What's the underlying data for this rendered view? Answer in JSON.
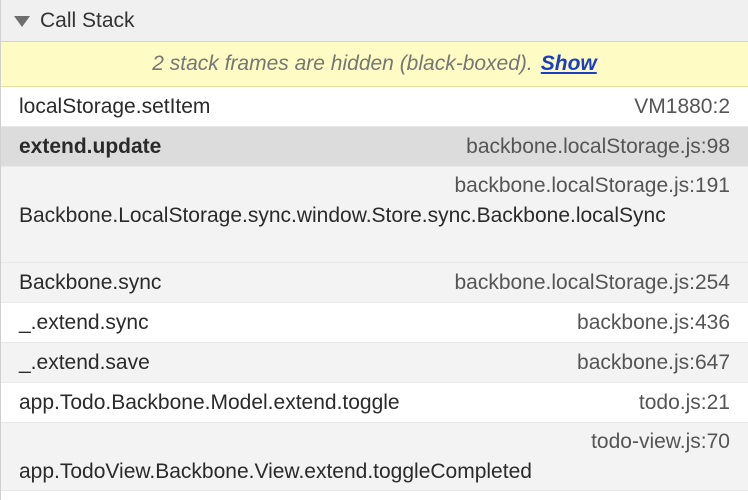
{
  "header": {
    "title": "Call Stack"
  },
  "banner": {
    "message": "2 stack frames are hidden (black-boxed).",
    "show_label": "Show"
  },
  "frames": [
    {
      "fn": "localStorage.setItem",
      "loc": "VM1880:2"
    },
    {
      "fn": "extend.update",
      "loc": "backbone.localStorage.js:98"
    },
    {
      "fn": "Backbone.LocalStorage.sync.window.Store.sync.Backbone.localSync",
      "loc": "backbone.localStorage.js:191"
    },
    {
      "fn": "Backbone.sync",
      "loc": "backbone.localStorage.js:254"
    },
    {
      "fn": "_.extend.sync",
      "loc": "backbone.js:436"
    },
    {
      "fn": "_.extend.save",
      "loc": "backbone.js:647"
    },
    {
      "fn": "app.Todo.Backbone.Model.extend.toggle",
      "loc": "todo.js:21"
    },
    {
      "fn": "app.TodoView.Backbone.View.extend.toggleCompleted",
      "loc": "todo-view.js:70"
    }
  ],
  "colors": {
    "banner_bg": "#fffbc4",
    "link": "#1a3fc0",
    "selected_bg": "#dcdcdc"
  }
}
